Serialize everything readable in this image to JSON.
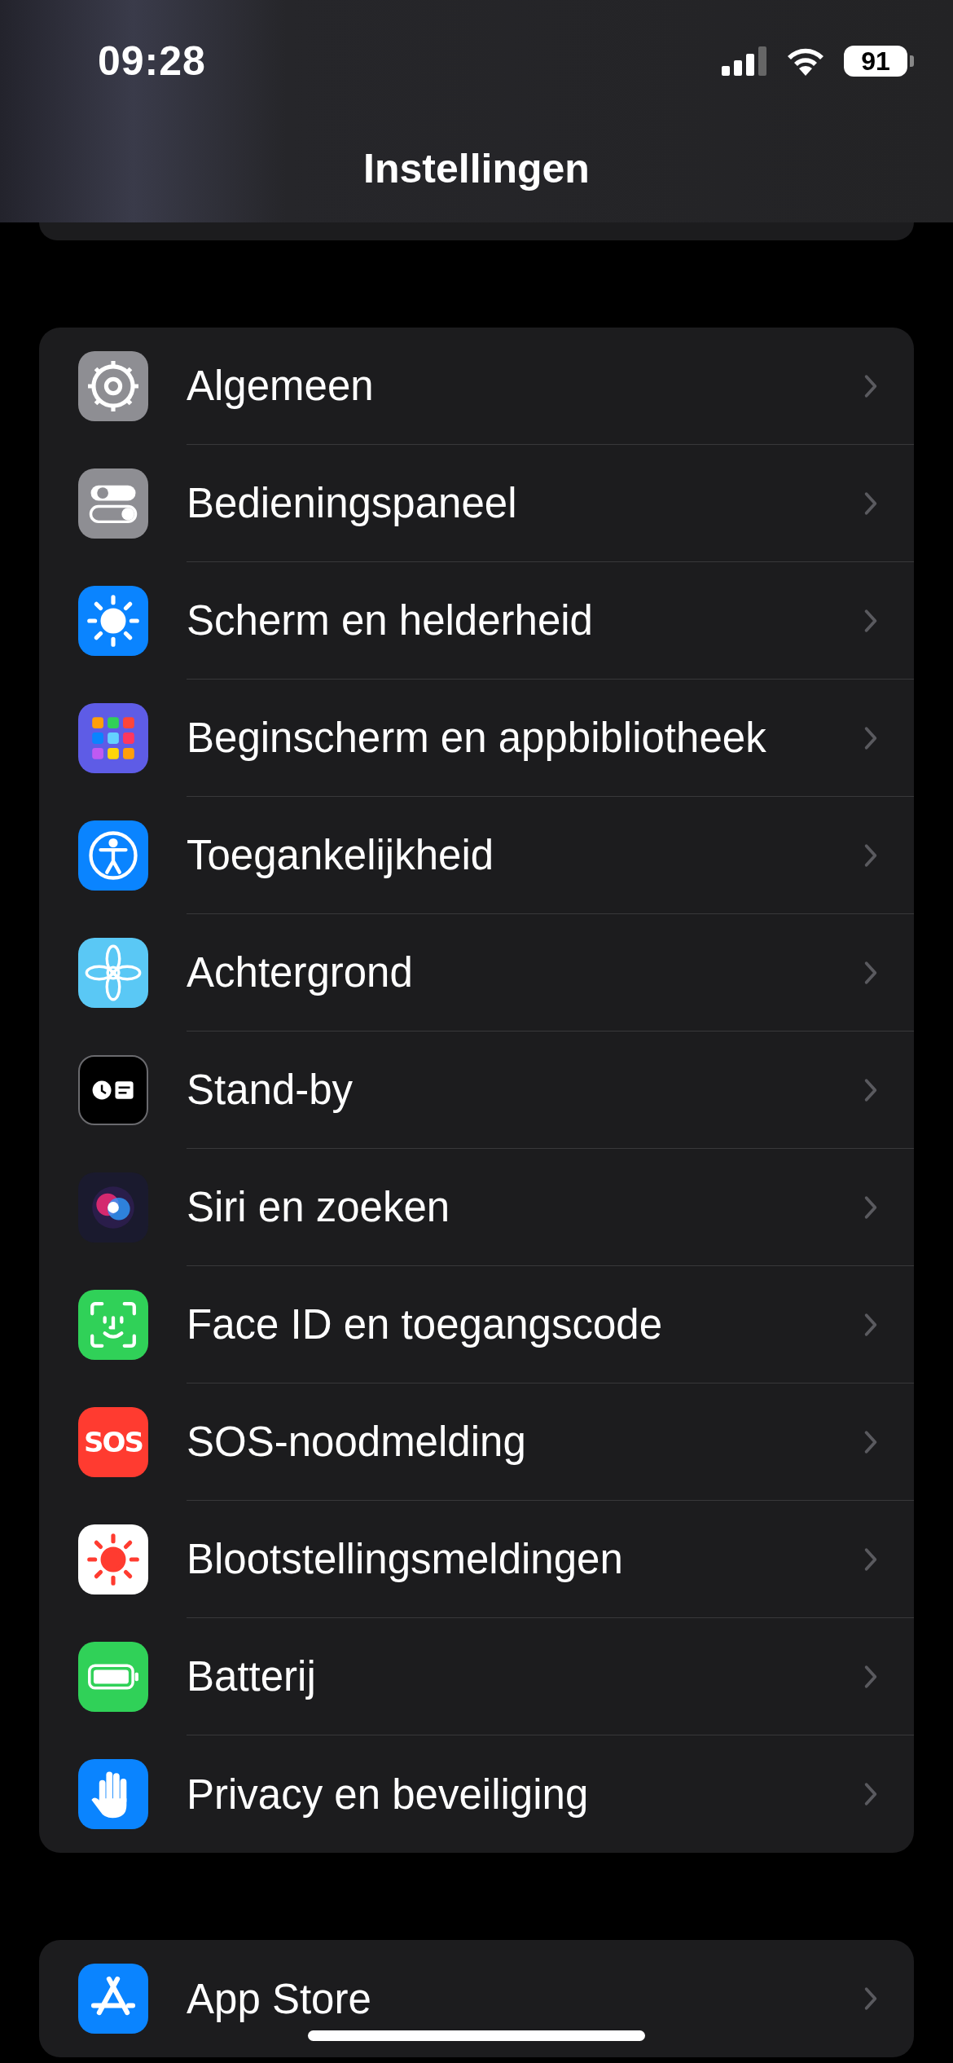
{
  "status_bar": {
    "time": "09:28",
    "battery": "91"
  },
  "title": "Instellingen",
  "sections": [
    {
      "items": [
        {
          "label": "Algemeen",
          "color": "#8e8e93"
        },
        {
          "label": "Bedieningspaneel",
          "color": "#8e8e93"
        },
        {
          "label": "Scherm en helderheid",
          "color": "#0a84ff"
        },
        {
          "label": "Beginscherm en appbibliotheek",
          "color": "#5e5ce6"
        },
        {
          "label": "Toegankelijkheid",
          "color": "#0a84ff"
        },
        {
          "label": "Achtergrond",
          "color": "#5ac8f5"
        },
        {
          "label": "Stand-by",
          "color": "#000000"
        },
        {
          "label": "Siri en zoeken",
          "color": "#1a1a2e"
        },
        {
          "label": "Face ID en toegangscode",
          "color": "#30d158"
        },
        {
          "label": "SOS-noodmelding",
          "color": "#ff3b30",
          "icon_text": "SOS"
        },
        {
          "label": "Blootstellingsmeldingen",
          "color": "#ffffff"
        },
        {
          "label": "Batterij",
          "color": "#30d158"
        },
        {
          "label": "Privacy en beveiliging",
          "color": "#0a84ff"
        }
      ]
    },
    {
      "items": [
        {
          "label": "App Store",
          "color": "#0a84ff"
        }
      ]
    }
  ]
}
